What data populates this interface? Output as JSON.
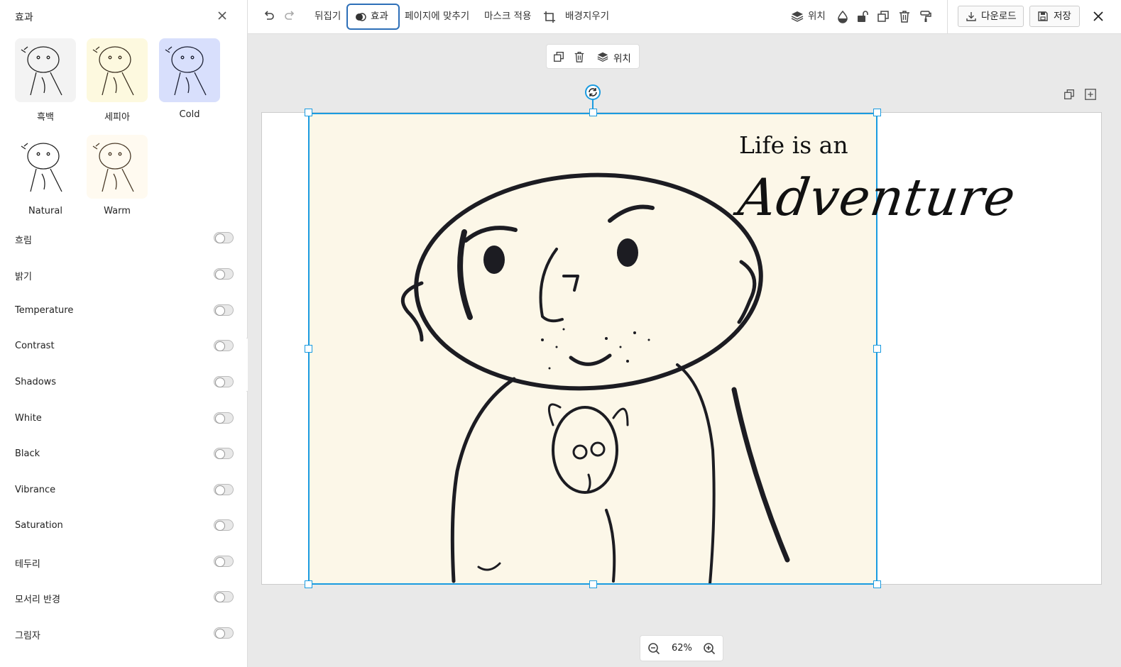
{
  "sidebar": {
    "title": "효과",
    "filters": [
      {
        "label": "흑백"
      },
      {
        "label": "세피아"
      },
      {
        "label": "Cold"
      },
      {
        "label": "Natural"
      },
      {
        "label": "Warm"
      }
    ],
    "adjustments": [
      {
        "label": "흐림"
      },
      {
        "label": "밝기"
      },
      {
        "label": "Temperature"
      },
      {
        "label": "Contrast"
      },
      {
        "label": "Shadows"
      },
      {
        "label": "White"
      },
      {
        "label": "Black"
      },
      {
        "label": "Vibrance"
      },
      {
        "label": "Saturation"
      },
      {
        "label": "테두리"
      },
      {
        "label": "모서리 반경"
      },
      {
        "label": "그림자"
      }
    ]
  },
  "toolbar": {
    "flip": "뒤집기",
    "effect": "효과",
    "fit_page": "페이지에 맞추기",
    "apply_mask": "마스크 적용",
    "remove_bg": "배경지우기",
    "position": "위치",
    "download": "다운로드",
    "save": "저장"
  },
  "floating_toolbar": {
    "position": "위치"
  },
  "canvas": {
    "text_line1": "Life is an",
    "text_line2": "Adventure"
  },
  "zoom": {
    "value": "62%"
  },
  "colors": {
    "accent": "#1a9be0",
    "effect_border": "#2d6fb8",
    "paper": "#fcf7e8"
  }
}
